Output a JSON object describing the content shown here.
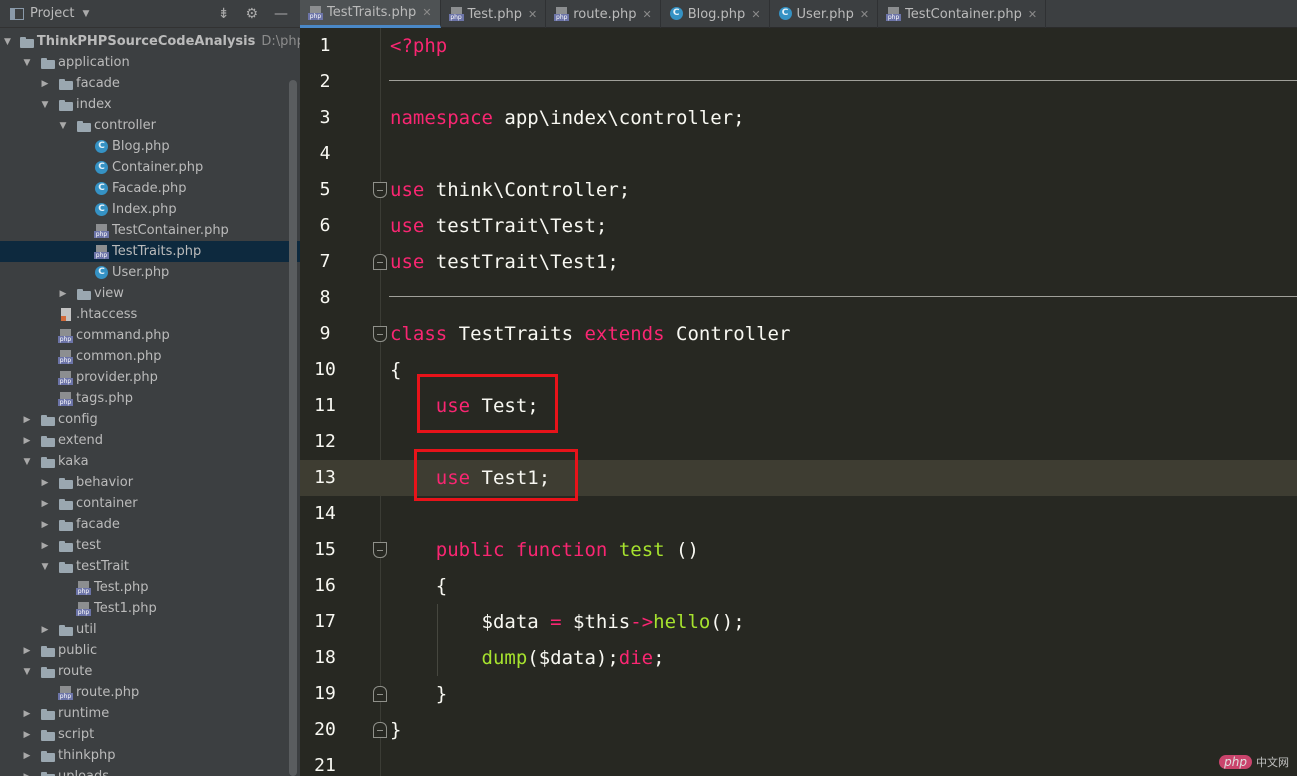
{
  "project_panel": {
    "title": "Project",
    "tree": [
      {
        "label": "ThinkPHPSourceCodeAnalysis",
        "path": "D:\\phpstudy",
        "depth": 0,
        "type": "folder",
        "arrow": "open",
        "bold": true
      },
      {
        "label": "application",
        "depth": 1,
        "type": "folder",
        "arrow": "open"
      },
      {
        "label": "facade",
        "depth": 2,
        "type": "folder",
        "arrow": "closed"
      },
      {
        "label": "index",
        "depth": 2,
        "type": "folder",
        "arrow": "open"
      },
      {
        "label": "controller",
        "depth": 3,
        "type": "folder",
        "arrow": "open"
      },
      {
        "label": "Blog.php",
        "depth": 4,
        "type": "class",
        "arrow": "none"
      },
      {
        "label": "Container.php",
        "depth": 4,
        "type": "class",
        "arrow": "none"
      },
      {
        "label": "Facade.php",
        "depth": 4,
        "type": "class",
        "arrow": "none"
      },
      {
        "label": "Index.php",
        "depth": 4,
        "type": "class",
        "arrow": "none"
      },
      {
        "label": "TestContainer.php",
        "depth": 4,
        "type": "php",
        "arrow": "none"
      },
      {
        "label": "TestTraits.php",
        "depth": 4,
        "type": "php",
        "arrow": "none",
        "selected": true
      },
      {
        "label": "User.php",
        "depth": 4,
        "type": "class",
        "arrow": "none"
      },
      {
        "label": "view",
        "depth": 3,
        "type": "folder",
        "arrow": "closed"
      },
      {
        "label": ".htaccess",
        "depth": 2,
        "type": "htaccess",
        "arrow": "none"
      },
      {
        "label": "command.php",
        "depth": 2,
        "type": "php",
        "arrow": "none"
      },
      {
        "label": "common.php",
        "depth": 2,
        "type": "php",
        "arrow": "none"
      },
      {
        "label": "provider.php",
        "depth": 2,
        "type": "php",
        "arrow": "none"
      },
      {
        "label": "tags.php",
        "depth": 2,
        "type": "php",
        "arrow": "none"
      },
      {
        "label": "config",
        "depth": 1,
        "type": "folder",
        "arrow": "closed"
      },
      {
        "label": "extend",
        "depth": 1,
        "type": "folder",
        "arrow": "closed"
      },
      {
        "label": "kaka",
        "depth": 1,
        "type": "folder",
        "arrow": "open"
      },
      {
        "label": "behavior",
        "depth": 2,
        "type": "folder",
        "arrow": "closed"
      },
      {
        "label": "container",
        "depth": 2,
        "type": "folder",
        "arrow": "closed"
      },
      {
        "label": "facade",
        "depth": 2,
        "type": "folder",
        "arrow": "closed"
      },
      {
        "label": "test",
        "depth": 2,
        "type": "folder",
        "arrow": "closed"
      },
      {
        "label": "testTrait",
        "depth": 2,
        "type": "folder",
        "arrow": "open"
      },
      {
        "label": "Test.php",
        "depth": 3,
        "type": "php",
        "arrow": "none"
      },
      {
        "label": "Test1.php",
        "depth": 3,
        "type": "php",
        "arrow": "none"
      },
      {
        "label": "util",
        "depth": 2,
        "type": "folder",
        "arrow": "closed"
      },
      {
        "label": "public",
        "depth": 1,
        "type": "folder",
        "arrow": "closed"
      },
      {
        "label": "route",
        "depth": 1,
        "type": "folder",
        "arrow": "open"
      },
      {
        "label": "route.php",
        "depth": 2,
        "type": "php",
        "arrow": "none"
      },
      {
        "label": "runtime",
        "depth": 1,
        "type": "folder",
        "arrow": "closed"
      },
      {
        "label": "script",
        "depth": 1,
        "type": "folder",
        "arrow": "closed"
      },
      {
        "label": "thinkphp",
        "depth": 1,
        "type": "folder",
        "arrow": "closed"
      },
      {
        "label": "uploads",
        "depth": 1,
        "type": "folder",
        "arrow": "closed"
      }
    ]
  },
  "tabs": [
    {
      "label": "TestTraits.php",
      "icon": "php-file-icon",
      "active": true
    },
    {
      "label": "Test.php",
      "icon": "php-file-icon"
    },
    {
      "label": "route.php",
      "icon": "php-file-icon"
    },
    {
      "label": "Blog.php",
      "icon": "php-class-icon"
    },
    {
      "label": "User.php",
      "icon": "php-class-icon"
    },
    {
      "label": "TestContainer.php",
      "icon": "php-file-icon"
    }
  ],
  "editor": {
    "current_line": 13,
    "lines": [
      {
        "n": "1",
        "tokens": [
          [
            "kw",
            "<?php"
          ]
        ]
      },
      {
        "n": "2",
        "tokens": [],
        "separator": true
      },
      {
        "n": "3",
        "tokens": [
          [
            "kw",
            "namespace"
          ],
          [
            "",
            " app\\index\\controller;"
          ]
        ]
      },
      {
        "n": "4",
        "tokens": []
      },
      {
        "n": "5",
        "tokens": [
          [
            "kw",
            "use"
          ],
          [
            "",
            " think\\Controller;"
          ]
        ],
        "fold": "open"
      },
      {
        "n": "6",
        "tokens": [
          [
            "kw",
            "use"
          ],
          [
            "",
            " testTrait\\Test;"
          ]
        ]
      },
      {
        "n": "7",
        "tokens": [
          [
            "kw",
            "use"
          ],
          [
            "",
            " testTrait\\Test1;"
          ]
        ],
        "fold": "close"
      },
      {
        "n": "8",
        "tokens": [],
        "separator": true
      },
      {
        "n": "9",
        "tokens": [
          [
            "kw",
            "class"
          ],
          [
            "",
            " TestTraits "
          ],
          [
            "kw",
            "extends"
          ],
          [
            "",
            " Controller"
          ]
        ],
        "fold": "open"
      },
      {
        "n": "10",
        "tokens": [
          [
            "",
            "{"
          ]
        ]
      },
      {
        "n": "11",
        "tokens": [
          [
            "",
            "    "
          ],
          [
            "kw",
            "use"
          ],
          [
            "",
            " Test;"
          ]
        ]
      },
      {
        "n": "12",
        "tokens": []
      },
      {
        "n": "13",
        "tokens": [
          [
            "",
            "    "
          ],
          [
            "kw",
            "use"
          ],
          [
            "",
            " Test1;"
          ]
        ]
      },
      {
        "n": "14",
        "tokens": []
      },
      {
        "n": "15",
        "tokens": [
          [
            "",
            "    "
          ],
          [
            "kw",
            "public"
          ],
          [
            "",
            " "
          ],
          [
            "kw",
            "function"
          ],
          [
            "",
            " "
          ],
          [
            "fn",
            "test"
          ],
          [
            "",
            " ()"
          ]
        ],
        "fold": "open"
      },
      {
        "n": "16",
        "tokens": [
          [
            "",
            "    {"
          ]
        ]
      },
      {
        "n": "17",
        "tokens": [
          [
            "",
            "        $data "
          ],
          [
            "kw",
            "="
          ],
          [
            "",
            " $this"
          ],
          [
            "kw",
            "->"
          ],
          [
            "fn",
            "hello"
          ],
          [
            "",
            "();"
          ]
        ]
      },
      {
        "n": "18",
        "tokens": [
          [
            "",
            "        "
          ],
          [
            "fn",
            "dump"
          ],
          [
            "",
            "($data);"
          ],
          [
            "kw",
            "die"
          ],
          [
            "",
            ";"
          ]
        ]
      },
      {
        "n": "19",
        "tokens": [
          [
            "",
            "    }"
          ]
        ],
        "fold": "close"
      },
      {
        "n": "20",
        "tokens": [
          [
            "",
            "}"
          ]
        ],
        "fold": "close"
      },
      {
        "n": "21",
        "tokens": []
      }
    ]
  },
  "watermark": {
    "logo": "php",
    "site": "中文网"
  }
}
